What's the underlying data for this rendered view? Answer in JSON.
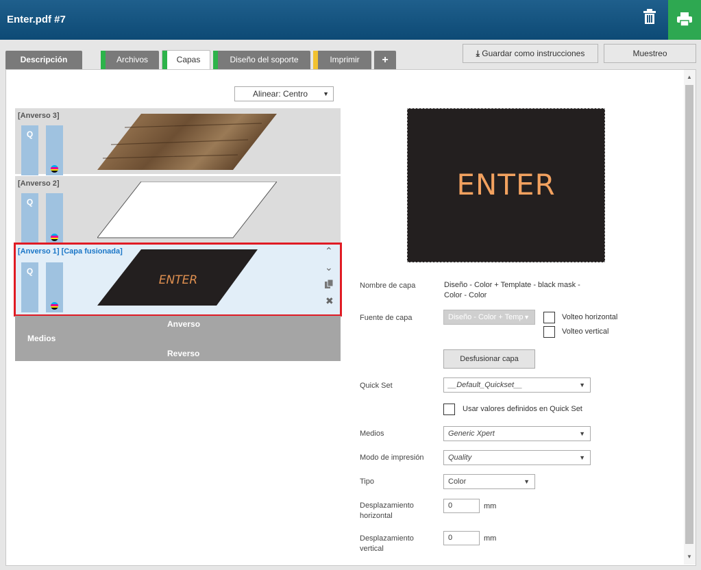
{
  "window": {
    "title": "Enter.pdf #7"
  },
  "colors": {
    "header": "#0d4a75",
    "print_button": "#2ea851",
    "selected_outline": "#e01b24",
    "tab_green": "#2db34a",
    "tab_yellow": "#f2c230"
  },
  "tabs": [
    {
      "label": "Descripción"
    },
    {
      "label": "Archivos"
    },
    {
      "label": "Capas"
    },
    {
      "label": "Diseño del soporte"
    },
    {
      "label": "Imprimir"
    },
    {
      "label": "+"
    }
  ],
  "toolbar": {
    "save_label": "Guardar como instrucciones",
    "sample_label": "Muestreo"
  },
  "align": {
    "value": "Alinear: Centro"
  },
  "layers": [
    {
      "label": "[Anverso 3]",
      "quick": "Q"
    },
    {
      "label": "[Anverso 2]",
      "quick": "Q"
    },
    {
      "label": "[Anverso 1] [Capa fusionada]",
      "quick": "Q",
      "art_text": "ENTER"
    }
  ],
  "media": {
    "front": "Anverso",
    "media": "Medios",
    "back": "Reverso"
  },
  "preview": {
    "text": "ENTER"
  },
  "form": {
    "layer_name_label": "Nombre de capa",
    "layer_name_value_1": "Diseño - Color + Template - black mask -",
    "layer_name_value_2": "Color - Color",
    "layer_source_label": "Fuente de capa",
    "layer_source_value": "Diseño - Color + Temp",
    "flip_h": "Volteo horizontal",
    "flip_v": "Volteo vertical",
    "unmerge": "Desfusionar capa",
    "quickset_label": "Quick Set",
    "quickset_value": "__Default_Quickset__",
    "use_quickset": "Usar valores definidos en Quick Set",
    "media_label": "Medios",
    "media_value": "Generic Xpert",
    "mode_label": "Modo de impresión",
    "mode_value": "Quality",
    "type_label": "Tipo",
    "type_value": "Color",
    "offset_h_label_1": "Desplazamiento",
    "offset_h_label_2": "horizontal",
    "offset_h_value": "0",
    "offset_v_label_1": "Desplazamiento",
    "offset_v_label_2": "vertical",
    "offset_v_value": "0",
    "unit": "mm"
  }
}
